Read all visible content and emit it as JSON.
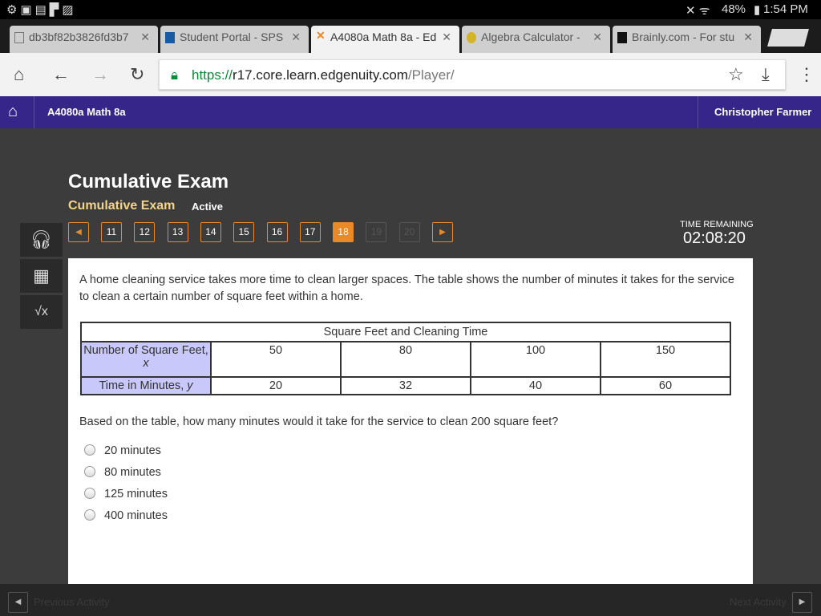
{
  "status": {
    "battery": "48%",
    "time": "1:54 PM"
  },
  "tabs": [
    {
      "label": "db3bf82b3826fd3b7"
    },
    {
      "label": "Student Portal - SPS"
    },
    {
      "label": "A4080a Math 8a - Ed"
    },
    {
      "label": "Algebra Calculator -"
    },
    {
      "label": "Brainly.com - For stu"
    }
  ],
  "url": {
    "scheme": "https://",
    "host": "r17.core.learn.edgenuity.com",
    "path": "/Player/"
  },
  "header": {
    "course": "A4080a Math 8a",
    "user": "Christopher Farmer"
  },
  "exam": {
    "title": "Cumulative Exam",
    "subtitle": "Cumulative Exam",
    "status": "Active"
  },
  "questions": [
    "11",
    "12",
    "13",
    "14",
    "15",
    "16",
    "17",
    "18",
    "19",
    "20"
  ],
  "current_question": "18",
  "timer": {
    "label": "TIME REMAINING",
    "value": "02:08:20"
  },
  "question": {
    "intro": "A home cleaning service takes more time to clean larger spaces. The table shows the number of minutes it takes for the service to clean a certain number of square feet within a home.",
    "table": {
      "caption": "Square Feet and Cleaning Time",
      "row1_label": "Number of Square Feet,",
      "row1_var": "x",
      "row1": [
        "50",
        "80",
        "100",
        "150"
      ],
      "row2_label": "Time in Minutes, ",
      "row2_var": "y",
      "row2": [
        "20",
        "32",
        "40",
        "60"
      ]
    },
    "prompt": "Based on the table, how many minutes would it take for the service to clean 200 square feet?",
    "options": [
      "20 minutes",
      "80 minutes",
      "125 minutes",
      "400 minutes"
    ]
  },
  "footer": {
    "prev": "Previous Activity",
    "next": "Next Activity"
  }
}
